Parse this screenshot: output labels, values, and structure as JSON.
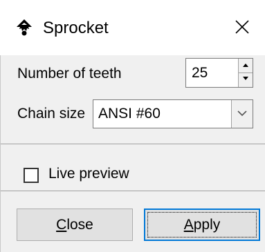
{
  "window": {
    "title": "Sprocket",
    "icon": "inkscape-logo-icon",
    "close_icon": "close-icon"
  },
  "fields": {
    "teeth_label": "Number of teeth",
    "teeth_value": "25",
    "chain_label": "Chain size",
    "chain_value": "ANSI #60"
  },
  "options": {
    "live_preview_label": "Live preview",
    "live_preview_checked": false
  },
  "buttons": {
    "close_mnemonic": "C",
    "close_rest": "lose",
    "apply_mnemonic": "A",
    "apply_rest": "pply"
  },
  "colors": {
    "panel": "#f0f0f0",
    "focus_border": "#0078d7"
  }
}
